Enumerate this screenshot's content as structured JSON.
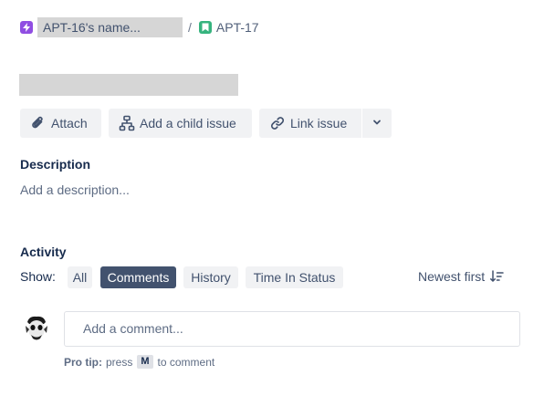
{
  "breadcrumb": {
    "parent_label": "APT-16's name...",
    "separator": "/",
    "issue_key": "APT-17",
    "parent_icon": "epic-lightning-icon",
    "issue_icon": "story-bookmark-icon"
  },
  "toolbar": {
    "attach_label": "Attach",
    "add_child_label": "Add a child issue",
    "link_issue_label": "Link issue",
    "icons": [
      "paperclip-icon",
      "child-hierarchy-icon",
      "link-icon",
      "chevron-down-icon"
    ]
  },
  "description": {
    "heading": "Description",
    "placeholder": "Add a description..."
  },
  "activity": {
    "heading": "Activity",
    "show_label": "Show:",
    "filters": [
      {
        "label": "All",
        "active": false
      },
      {
        "label": "Comments",
        "active": true
      },
      {
        "label": "History",
        "active": false
      },
      {
        "label": "Time In Status",
        "active": false
      }
    ],
    "sort_label": "Newest first"
  },
  "comment": {
    "placeholder": "Add a comment...",
    "protip_bold": "Pro tip:",
    "protip_press": "press",
    "protip_key": "M",
    "protip_suffix": "to comment"
  },
  "colors": {
    "epic": "#904ee2",
    "story": "#36b37e",
    "active_filter": "#42526e",
    "button_bg": "#f1f2f4"
  }
}
